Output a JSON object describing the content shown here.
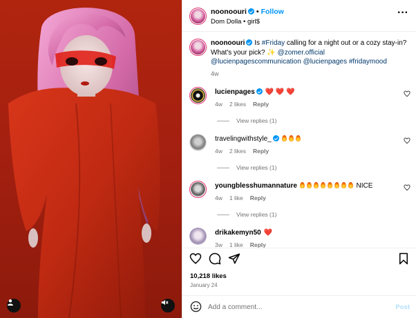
{
  "post": {
    "username": "noonoouri",
    "follow_label": "Follow",
    "separator": "•",
    "audio": "Dom Dolla • girl$",
    "more_icon": "more-horizontal-icon"
  },
  "caption": {
    "username": "noonoouri",
    "text_1": " Is ",
    "hashtag_friday": "#Friday",
    "text_2": " calling for a night out or a cozy stay-in? What's your pick? ✨ ",
    "mention_zomer": "@zomer.official",
    "mention_lucien_comm": "@lucienpagescommunication",
    "mention_lucien": "@lucienpages",
    "hashtag_mood": "#fridaymood",
    "age": "4w"
  },
  "comments": [
    {
      "username": "lucienpages",
      "verified": true,
      "text": "❤️ ❤️ ❤️",
      "age": "4w",
      "likes": "2 likes",
      "reply": "Reply",
      "view_replies": "View replies (1)"
    },
    {
      "username": "travelingwithstyle_",
      "verified": true,
      "flames": 3,
      "text": "",
      "age": "4w",
      "likes": "2 likes",
      "reply": "Reply",
      "view_replies": "View replies (1)"
    },
    {
      "username": "youngblesshumannature",
      "verified": false,
      "flames": 8,
      "text": "NICE",
      "age": "4w",
      "likes": "1 like",
      "reply": "Reply",
      "view_replies": "View replies (1)"
    },
    {
      "username": "drikakemyn50",
      "verified": false,
      "text": "❤️",
      "age": "3w",
      "likes": "1 like",
      "reply": "Reply"
    }
  ],
  "actions": {
    "likes": "10,218 likes",
    "date": "January 24"
  },
  "composer": {
    "placeholder": "Add a comment...",
    "post_label": "Post"
  },
  "colors": {
    "accent": "#0095f6",
    "media_bg": "#a52010",
    "heart_red": "#e0245e"
  }
}
